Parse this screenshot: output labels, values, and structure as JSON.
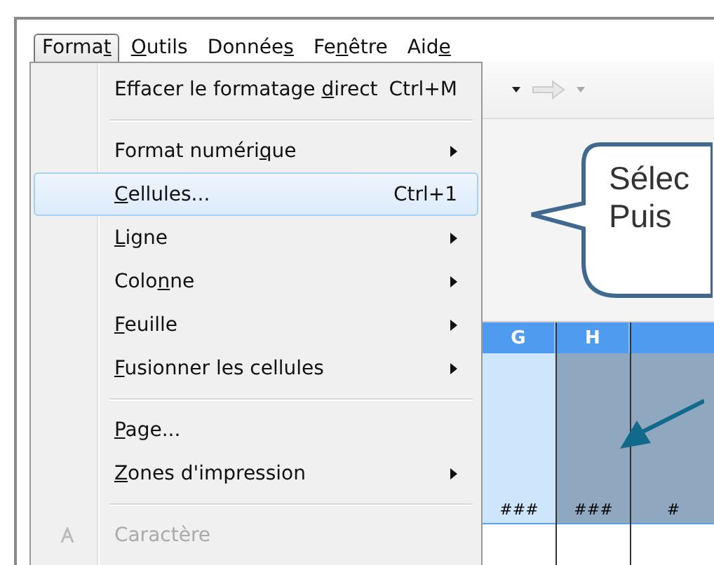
{
  "menubar": [
    {
      "label": {
        "before": "Forma",
        "key": "t"
      },
      "selected": true
    },
    {
      "label": {
        "key": "O",
        "after": "utils"
      },
      "selected": false
    },
    {
      "label": {
        "before": "Donnée",
        "key": "s"
      },
      "selected": false
    },
    {
      "label": {
        "before": "Fe",
        "key": "n",
        "after": "être"
      },
      "selected": false
    },
    {
      "label": {
        "before": "Aid",
        "key": "e"
      },
      "selected": false
    }
  ],
  "menu": {
    "items": [
      {
        "kind": "item",
        "label": {
          "before": "Effacer le formatage ",
          "key": "d",
          "after": "irect"
        },
        "shortcut": "Ctrl+M",
        "submenu": false,
        "highlighted": false,
        "disabled": false
      },
      {
        "kind": "separator"
      },
      {
        "kind": "item",
        "label": {
          "before": "Format numéri",
          "key": "q",
          "after": "ue"
        },
        "submenu": true,
        "highlighted": false,
        "disabled": false
      },
      {
        "kind": "item",
        "label": {
          "key": "C",
          "after": "ellules..."
        },
        "shortcut": "Ctrl+1",
        "submenu": false,
        "highlighted": true,
        "disabled": false
      },
      {
        "kind": "item",
        "label": {
          "key": "L",
          "after": "igne"
        },
        "submenu": true,
        "highlighted": false,
        "disabled": false
      },
      {
        "kind": "item",
        "label": {
          "before": "Colo",
          "key": "n",
          "after": "ne"
        },
        "submenu": true,
        "highlighted": false,
        "disabled": false
      },
      {
        "kind": "item",
        "label": {
          "key": "F",
          "after": "euille"
        },
        "submenu": true,
        "highlighted": false,
        "disabled": false
      },
      {
        "kind": "item",
        "label": {
          "key": "F",
          "after": "usionner les cellules"
        },
        "submenu": true,
        "highlighted": false,
        "disabled": false
      },
      {
        "kind": "separator"
      },
      {
        "kind": "item",
        "label": {
          "key": "P",
          "after": "age..."
        },
        "submenu": false,
        "highlighted": false,
        "disabled": false
      },
      {
        "kind": "item",
        "label": {
          "key": "Z",
          "after": "ones d'impression"
        },
        "submenu": true,
        "highlighted": false,
        "disabled": false
      },
      {
        "kind": "separator"
      },
      {
        "kind": "item",
        "label": {
          "before": "Caractère"
        },
        "submenu": false,
        "highlighted": false,
        "disabled": true
      }
    ]
  },
  "sheet": {
    "columns": [
      {
        "header": "G",
        "cell": "###",
        "highlighted": false
      },
      {
        "header": "H",
        "cell": "###",
        "highlighted": true
      },
      {
        "cell": "#",
        "highlighted": true
      }
    ]
  },
  "callout": {
    "lines": [
      "Sélec",
      "Puis"
    ]
  }
}
